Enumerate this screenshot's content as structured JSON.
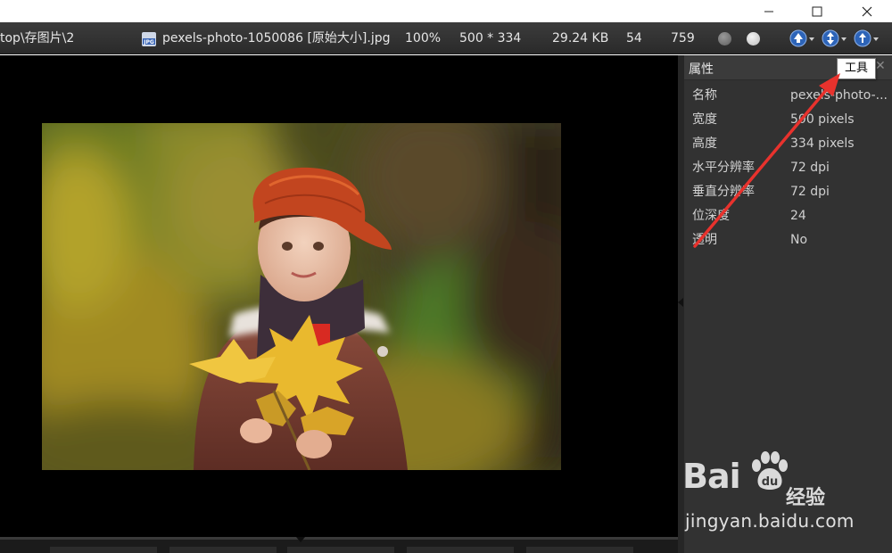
{
  "window": {
    "minimize_icon": "minimize-icon",
    "maximize_icon": "maximize-icon",
    "close_icon": "close-icon"
  },
  "infobar": {
    "path": "top\\存图片\\2",
    "file_icon": "jpg-file-icon",
    "file_name": "pexels-photo-1050086 [原始大小].jpg",
    "zoom": "100%",
    "dimensions": "500 * 334",
    "file_size": "29.24 KB",
    "value_a": "54",
    "value_b": "759",
    "nav_buttons": [
      "previous-icon",
      "next-icon",
      "info-icon"
    ]
  },
  "panel": {
    "title": "属性",
    "tooltip": "工具",
    "properties": [
      {
        "key": "名称",
        "value": "pexels-photo-..."
      },
      {
        "key": "宽度",
        "value": "500 pixels"
      },
      {
        "key": "高度",
        "value": "334 pixels"
      },
      {
        "key": "水平分辨率",
        "value": "72 dpi"
      },
      {
        "key": "垂直分辨率",
        "value": "72 dpi"
      },
      {
        "key": "位深度",
        "value": "24"
      },
      {
        "key": "透明",
        "value": "No"
      }
    ]
  },
  "watermark": {
    "logo": "Bai",
    "logo_tail": "经验",
    "url": "jingyan.baidu.com"
  },
  "colors": {
    "annotation_arrow": "#e8322d",
    "viewer_background": "#000000",
    "panel_background": "#323232"
  }
}
